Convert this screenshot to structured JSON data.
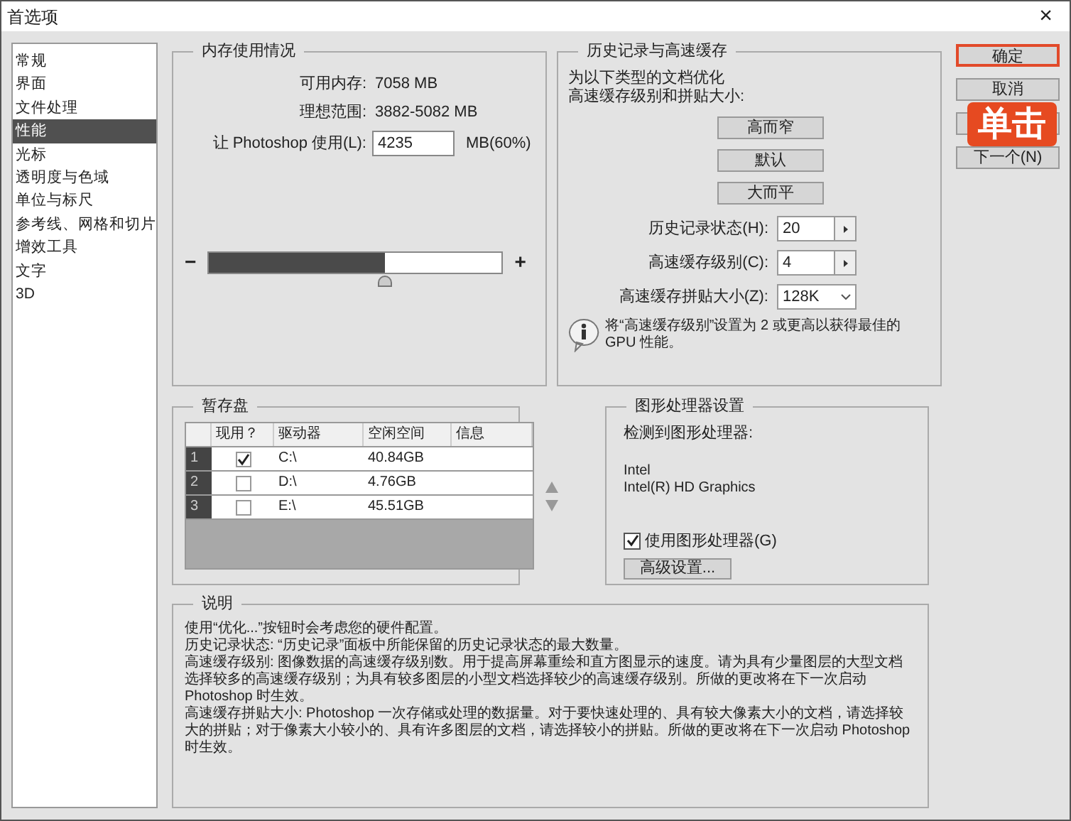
{
  "window": {
    "title": "首选项",
    "close": "×"
  },
  "sidebar": {
    "items": [
      {
        "label": "常规",
        "selected": false
      },
      {
        "label": "界面",
        "selected": false
      },
      {
        "label": "文件处理",
        "selected": false
      },
      {
        "label": "性能",
        "selected": true
      },
      {
        "label": "光标",
        "selected": false
      },
      {
        "label": "透明度与色域",
        "selected": false
      },
      {
        "label": "单位与标尺",
        "selected": false
      },
      {
        "label": "参考线、网格和切片",
        "selected": false
      },
      {
        "label": "增效工具",
        "selected": false
      },
      {
        "label": "文字",
        "selected": false
      },
      {
        "label": "3D",
        "selected": false
      }
    ]
  },
  "memory": {
    "title": "内存使用情况",
    "available_label": "可用内存:",
    "available": "7058 MB",
    "ideal_label": "理想范围:",
    "ideal": "3882-5082 MB",
    "use_label": "让 Photoshop 使用(L):",
    "use_value": "4235",
    "use_unit": "MB(60%)",
    "minus": "−",
    "plus": "+",
    "level": 0.6
  },
  "history": {
    "title": "历史记录与高速缓存",
    "intro": [
      "为以下类型的文档优化",
      "高速缓存级别和拼贴大小:"
    ],
    "presets": [
      "高而窄",
      "默认",
      "大而平"
    ],
    "fields": [
      {
        "kind": "stepper",
        "label": "历史记录状态(H):",
        "value": "20"
      },
      {
        "kind": "stepper",
        "label": "高速缓存级别(C):",
        "value": "4"
      },
      {
        "kind": "dropdown",
        "label": "高速缓存拼贴大小(Z):",
        "value": "128K"
      }
    ],
    "info": "将“高速缓存级别”设置为 2 或更高以获得最佳的 GPU 性能。"
  },
  "buttons": [
    {
      "label": "确定",
      "focused": true
    },
    {
      "label": "取消",
      "focused": false
    },
    {
      "focused": false
    },
    {
      "label": "下一个(N)",
      "focused": false
    }
  ],
  "callout": {
    "text": "单击"
  },
  "scratch": {
    "title": "暂存盘",
    "columns": [
      "现用？",
      "驱动器",
      "空闲空间",
      "信息"
    ],
    "rows": [
      {
        "index": "1",
        "checked": true,
        "drive": "C:\\",
        "free": "40.84GB"
      },
      {
        "index": "2",
        "checked": false,
        "drive": "D:\\",
        "free": "4.76GB"
      },
      {
        "index": "3",
        "checked": false,
        "drive": "E:\\",
        "free": "45.51GB"
      }
    ]
  },
  "gpu": {
    "title": "图形处理器设置",
    "detected": "检测到图形处理器:",
    "vendor": "Intel",
    "model": "Intel(R) HD Graphics",
    "use_label": "使用图形处理器(G)",
    "checked": true,
    "advanced": "高级设置..."
  },
  "description": {
    "title": "说明",
    "paragraphs": [
      "使用“优化...”按钮时会考虑您的硬件配置。",
      "历史记录状态: “历史记录”面板中所能保留的历史记录状态的最大数量。",
      "高速缓存级别: 图像数据的高速缓存级别数。用于提高屏幕重绘和直方图显示的速度。请为具有少量图层的大型文档选择较多的高速缓存级别；为具有较多图层的小型文档选择较少的高速缓存级别。所做的更改将在下一次启动 Photoshop 时生效。",
      "高速缓存拼贴大小: Photoshop 一次存储或处理的数据量。对于要快速处理的、具有较大像素大小的文档，请选择较大的拼贴；对于像素大小较小的、具有许多图层的文档，请选择较小的拼贴。所做的更改将在下一次启动 Photoshop 时生效。"
    ]
  }
}
